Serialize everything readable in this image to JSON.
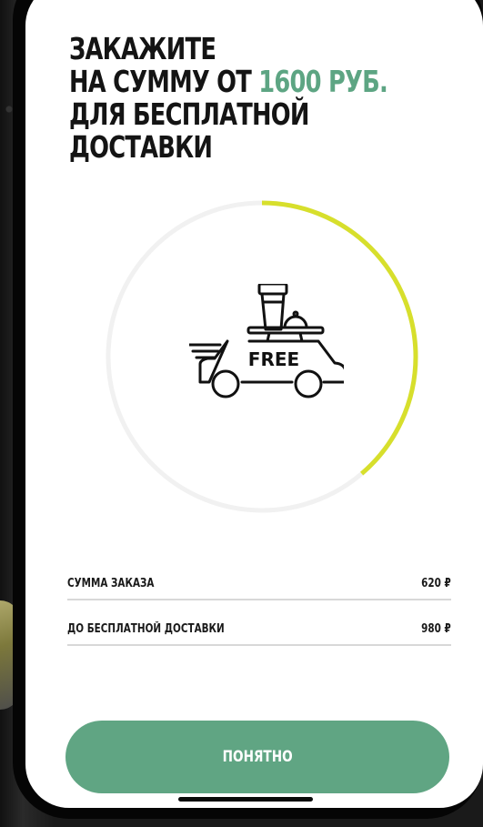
{
  "promo": {
    "title_line1": "ЗАКАЖИТЕ",
    "title_line2_prefix": "НА СУММУ ОТ ",
    "title_line2_accent": "1600 РУБ.",
    "title_line3": "ДЛЯ БЕСПЛАТНОЙ",
    "title_line4": "ДОСТАВКИ"
  },
  "progress": {
    "fraction": 0.3875,
    "track_color": "#f1f1f1",
    "fill_color": "#d7df2c"
  },
  "icon": {
    "name": "free-delivery-car-icon",
    "text": "FREE"
  },
  "summary": {
    "order_sum_label": "СУММА ЗАКАЗА",
    "order_sum_value": "620 ₽",
    "remaining_label": "ДО БЕСПЛАТНОЙ ДОСТАВКИ",
    "remaining_value": "980 ₽"
  },
  "actions": {
    "ok_label": "ПОНЯТНО"
  },
  "colors": {
    "accent": "#5da583",
    "button": "#60a583",
    "progress": "#d7df2c"
  }
}
